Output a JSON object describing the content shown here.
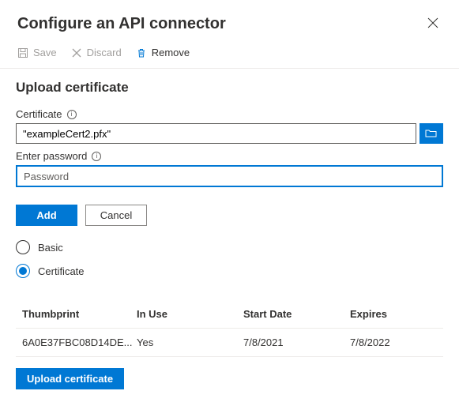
{
  "header": {
    "title": "Configure an API connector"
  },
  "toolbar": {
    "save": "Save",
    "discard": "Discard",
    "remove": "Remove"
  },
  "upload": {
    "heading": "Upload certificate",
    "cert_label": "Certificate",
    "cert_value": "\"exampleCert2.pfx\"",
    "password_label": "Enter password",
    "password_placeholder": "Password",
    "add": "Add",
    "cancel": "Cancel"
  },
  "auth": {
    "basic": "Basic",
    "certificate": "Certificate",
    "selected": "certificate"
  },
  "table": {
    "headers": {
      "thumbprint": "Thumbprint",
      "inuse": "In Use",
      "start": "Start Date",
      "expires": "Expires"
    },
    "rows": [
      {
        "thumbprint": "6A0E37FBC08D14DE...",
        "inuse": "Yes",
        "start": "7/8/2021",
        "expires": "7/8/2022"
      }
    ]
  },
  "footer": {
    "upload_cert": "Upload certificate"
  }
}
